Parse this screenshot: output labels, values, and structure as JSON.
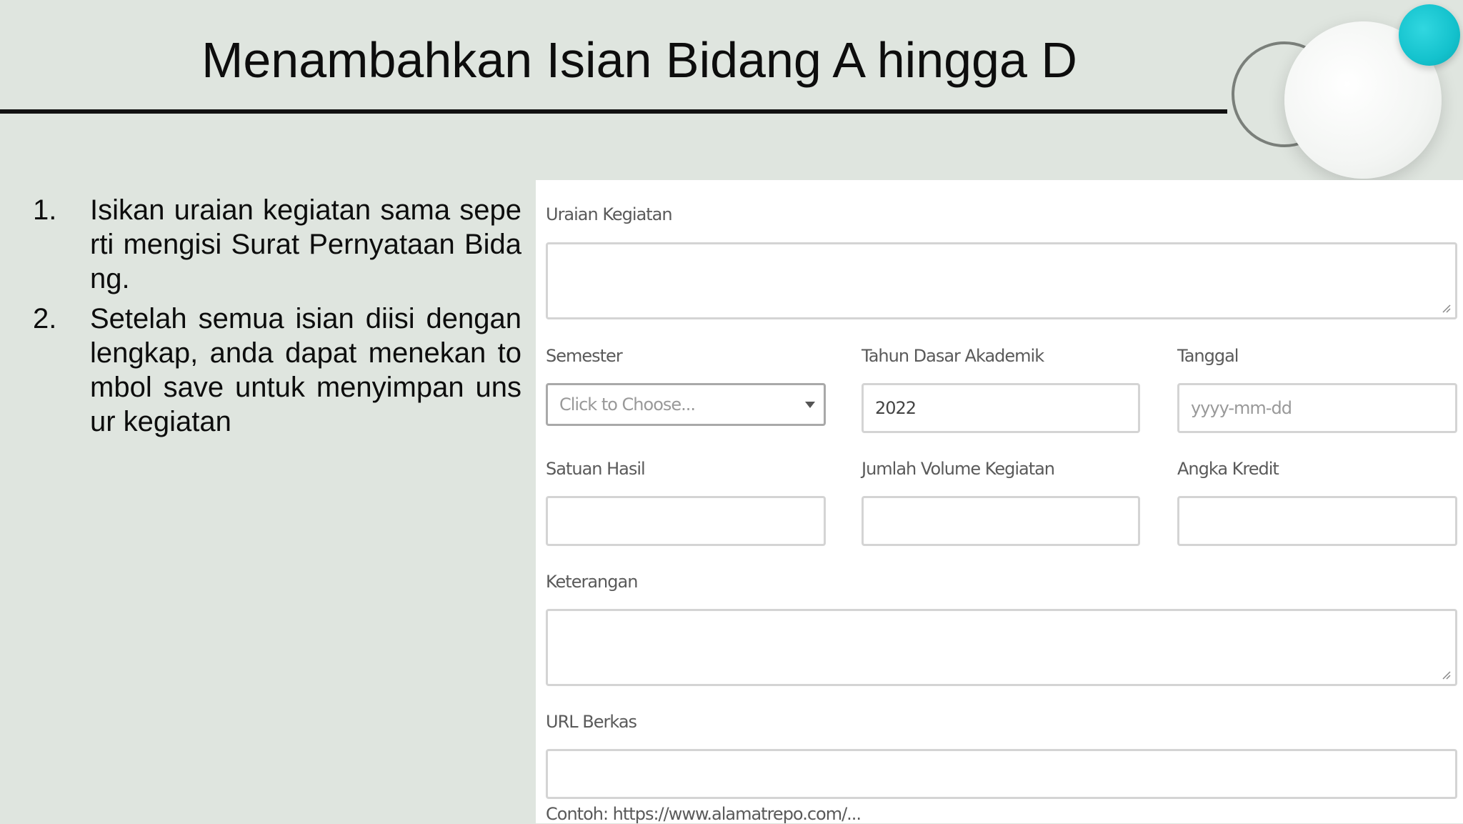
{
  "slide": {
    "title": "Menambahkan Isian Bidang A hingga D"
  },
  "instructions": [
    {
      "number": "1.",
      "text": "Isikan uraian kegiatan sama seperti mengisi Surat Pernyataan Bidang."
    },
    {
      "number": "2.",
      "text": "Setelah semua isian diisi dengan lengkap, anda dapat menekan tombol save untuk menyimpan unsur kegiatan"
    }
  ],
  "form": {
    "uraian_kegiatan": {
      "label": "Uraian Kegiatan",
      "value": ""
    },
    "semester": {
      "label": "Semester",
      "placeholder": "Click to Choose..."
    },
    "tahun_dasar_akademik": {
      "label": "Tahun Dasar Akademik",
      "value": "2022"
    },
    "tanggal": {
      "label": "Tanggal",
      "placeholder": "yyyy-mm-dd"
    },
    "satuan_hasil": {
      "label": "Satuan Hasil",
      "value": ""
    },
    "jumlah_volume_kegiatan": {
      "label": "Jumlah Volume Kegiatan",
      "value": ""
    },
    "angka_kredit": {
      "label": "Angka Kredit",
      "value": ""
    },
    "keterangan": {
      "label": "Keterangan",
      "value": ""
    },
    "url_berkas": {
      "label": "URL Berkas",
      "value": "",
      "help": "Contoh: https://www.alamatrepo.com/..."
    }
  },
  "colors": {
    "slide_background": "#dfe5df",
    "accent_teal": "#14c2cd",
    "title_rule": "#111111",
    "input_border": "#d4d4d4"
  }
}
